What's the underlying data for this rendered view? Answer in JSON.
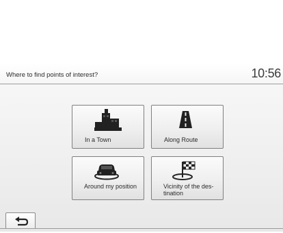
{
  "header": {
    "title": "Where to find points of interest?",
    "clock": "10:56"
  },
  "tiles": [
    {
      "label": "In a Town",
      "icon": "town-buildings-icon"
    },
    {
      "label": "Along Route",
      "icon": "road-route-icon"
    },
    {
      "label": "Around my position",
      "icon": "car-position-icon"
    },
    {
      "label": "Vicinity of the des-tination",
      "icon": "destination-flag-icon"
    }
  ],
  "footer": {
    "back_icon": "back-arrow-icon"
  },
  "colors": {
    "icon": "#222222",
    "tile_border": "#7f7f7f"
  }
}
